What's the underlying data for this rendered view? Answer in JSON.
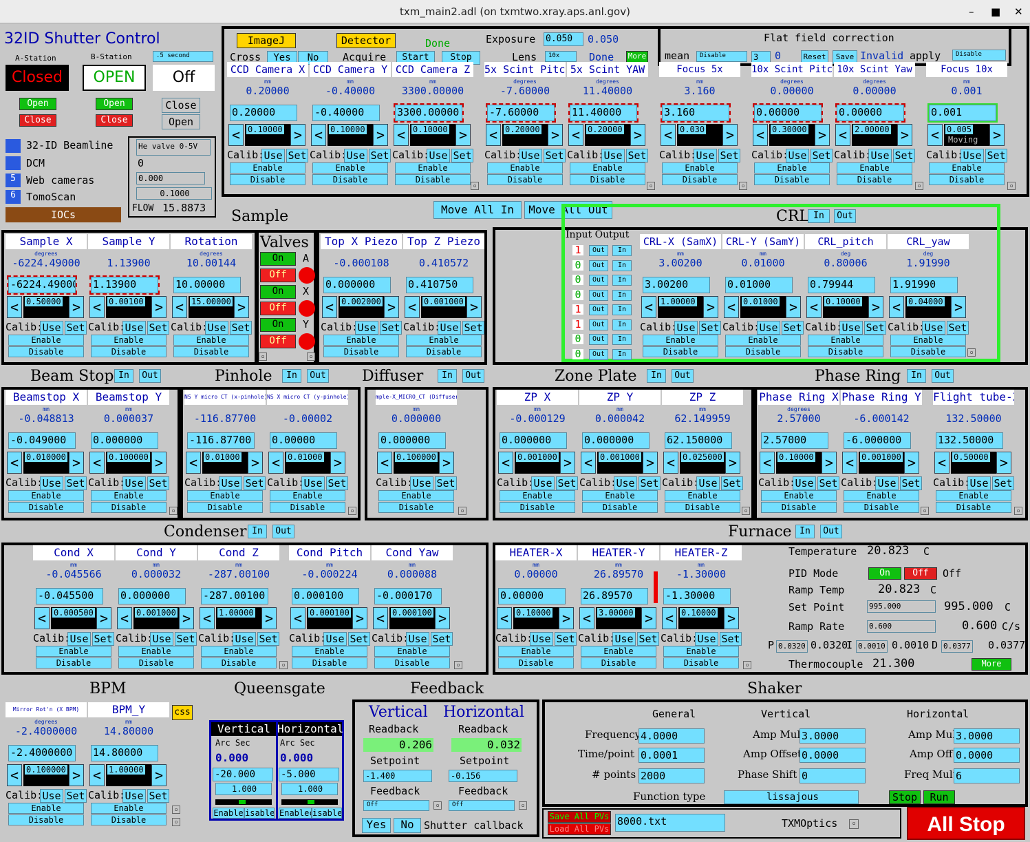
{
  "window": {
    "title": "txm_main2.adl (on txmtwo.xray.aps.anl.gov)",
    "minimize": "–",
    "maximize": "■",
    "close": "✕"
  },
  "shutter": {
    "title": "32ID Shutter Control",
    "a_label": "A-Station",
    "b_label": "B-Station",
    "a_state": "Closed",
    "b_state": "OPEN",
    "off": "Off",
    "rate": ".5 second",
    "open": "Open",
    "close": "Close",
    "close2": "Close",
    "open2": "Open",
    "colors": {
      "closed": "#e00000",
      "open": "#00a000"
    }
  },
  "nav": {
    "items": [
      {
        "num": "",
        "label": "32-ID Beamline"
      },
      {
        "num": "",
        "label": "DCM"
      },
      {
        "num": "5",
        "label": "Web cameras"
      },
      {
        "num": "6",
        "label": "TomoScan"
      }
    ],
    "iocs": "IOCs"
  },
  "he": {
    "label": "He valve 0-5V",
    "val": "0",
    "set": "0.000",
    "step": "0.1000",
    "flow_label": "FLOW",
    "flow": "15.8873"
  },
  "top": {
    "imagej": "ImageJ",
    "detector": "Detector",
    "done": "Done",
    "exposure": "Exposure",
    "exp_set": "0.050",
    "exp_rbv": "0.050",
    "cross": "Cross",
    "yes": "Yes",
    "no": "No",
    "acquire": "Acquire",
    "start": "Start",
    "stop": "Stop",
    "lens": "Lens",
    "lens_sel": "10x",
    "done2": "Done",
    "more": "More"
  },
  "flat": {
    "title": "Flat field correction",
    "mean": "mean",
    "mean_sel": "Disable",
    "n": "3",
    "n_rbv": "0",
    "reset": "Reset",
    "save": "Save",
    "invalid": "Invalid",
    "apply": "apply",
    "apply_sel": "Disable"
  },
  "calib_text": {
    "calib": "Calib:",
    "use": "Use",
    "set": "Set",
    "enable": "Enable",
    "disable": "Disable",
    "in": "In",
    "out": "Out"
  },
  "ccd_motors": [
    {
      "name": "CCD Camera X",
      "unit": "mm",
      "rbv": "0.20000",
      "set": "0.20000",
      "step": "0.10000"
    },
    {
      "name": "CCD Camera Y",
      "unit": "mm",
      "rbv": "-0.40000",
      "set": "-0.40000",
      "step": "0.10000"
    },
    {
      "name": "CCD Camera Z",
      "unit": "mm",
      "rbv": "3300.00000",
      "set": "3300.00000",
      "step": "0.10000"
    },
    {
      "name": "5x Scint Pitch",
      "unit": "degrees",
      "rbv": "-7.60000",
      "set": "-7.60000",
      "step": "0.20000"
    },
    {
      "name": "5x Scint YAW",
      "unit": "degrees",
      "rbv": "11.40000",
      "set": "11.40000",
      "step": "0.20000"
    },
    {
      "name": "Focus 5x",
      "unit": "mm",
      "rbv": "3.160",
      "set": "3.160",
      "step": "0.030"
    },
    {
      "name": "10x Scint Pitch",
      "unit": "degrees",
      "rbv": "0.00000",
      "set": "0.00000",
      "step": "0.30000"
    },
    {
      "name": "10x Scint Yaw",
      "unit": "degrees",
      "rbv": "0.00000",
      "set": "0.00000",
      "step": "2.00000"
    },
    {
      "name": "Focus 10x",
      "unit": "mm",
      "rbv": "0.001",
      "set": "0.001",
      "step": "0.005",
      "moving": "Moving"
    }
  ],
  "sample": {
    "title": "Sample",
    "move_all_in": "Move All In",
    "move_all_out": "Move All Out",
    "motors": [
      {
        "name": "Sample X",
        "unit": "degrees",
        "rbv": "-6224.49000",
        "set": "-6224.49000",
        "step": "0.50000"
      },
      {
        "name": "Sample Y",
        "unit": "",
        "rbv": "1.13900",
        "set": "1.13900",
        "step": "0.00100"
      },
      {
        "name": "Rotation",
        "unit": "degrees",
        "rbv": "10.00144",
        "set": "10.00000",
        "step": "15.00000"
      }
    ]
  },
  "valves": {
    "title": "Valves",
    "rows": [
      {
        "state": "On",
        "lbl": "A"
      },
      {
        "state": "Off",
        "lbl": ""
      },
      {
        "state": "On",
        "lbl": "X"
      },
      {
        "state": "Off",
        "lbl": ""
      },
      {
        "state": "On",
        "lbl": "Y"
      },
      {
        "state": "Off",
        "lbl": ""
      }
    ]
  },
  "piezo": [
    {
      "name": "Top X Piezo",
      "unit": "",
      "rbv": "-0.000108",
      "set": "0.000000",
      "step": "0.002000"
    },
    {
      "name": "Top Z Piezo",
      "unit": "",
      "rbv": "0.410572",
      "set": "0.410750",
      "step": "0.001000"
    }
  ],
  "crl": {
    "title": "CRL",
    "in": "In",
    "out": "Out",
    "io_header": "Input Output",
    "bits": [
      "1",
      "0",
      "0",
      "0",
      "1",
      "1",
      "0",
      "0"
    ],
    "motors": [
      {
        "name": "CRL-X (SamX)",
        "unit": "mm",
        "rbv": "3.00200",
        "set": "3.00200",
        "step": "1.00000"
      },
      {
        "name": "CRL-Y (SamY)",
        "unit": "mm",
        "rbv": "0.01000",
        "set": "0.01000",
        "step": "0.01000"
      },
      {
        "name": "CRL_pitch",
        "unit": "deg",
        "rbv": "0.80006",
        "set": "0.79944",
        "step": "0.10000"
      },
      {
        "name": "CRL_yaw",
        "unit": "deg",
        "rbv": "1.91990",
        "set": "1.91990",
        "step": "0.04000"
      }
    ]
  },
  "beamstop": {
    "title": "Beam Stop",
    "motors": [
      {
        "name": "Beamstop X",
        "unit": "mm",
        "rbv": "-0.048813",
        "set": "-0.049000",
        "step": "0.010000"
      },
      {
        "name": "Beamstop Y",
        "unit": "mm",
        "rbv": "0.000037",
        "set": "0.000000",
        "step": "0.100000"
      }
    ]
  },
  "pinhole": {
    "title": "Pinhole",
    "motors": [
      {
        "name": "NS Y micro CT (x-pinhole)",
        "unit": "",
        "rbv": "-116.87700",
        "set": "-116.87700",
        "step": "0.01000"
      },
      {
        "name": "NS X micro CT (y-pinhole)",
        "unit": "",
        "rbv": "-0.00002",
        "set": "0.00000",
        "step": "0.01000"
      }
    ]
  },
  "diffuser": {
    "title": "Diffuser",
    "motors": [
      {
        "name": "mple-X_MICRO_CT (Diffuser)",
        "unit": "mm",
        "rbv": "0.000000",
        "set": "0.000000",
        "step": "0.100000"
      }
    ]
  },
  "zoneplate": {
    "title": "Zone Plate",
    "motors": [
      {
        "name": "ZP X",
        "unit": "mm",
        "rbv": "-0.000129",
        "set": "0.000000",
        "step": "0.001000"
      },
      {
        "name": "ZP Y",
        "unit": "mm",
        "rbv": "0.000042",
        "set": "0.000000",
        "step": "0.001000"
      },
      {
        "name": "ZP Z",
        "unit": "mm",
        "rbv": "62.149959",
        "set": "62.150000",
        "step": "0.025000"
      }
    ]
  },
  "phasering": {
    "title": "Phase Ring",
    "motors": [
      {
        "name": "Phase Ring X",
        "unit": "degrees",
        "rbv": "2.57000",
        "set": "2.57000",
        "step": "0.10000"
      },
      {
        "name": "Phase Ring Y",
        "unit": "",
        "rbv": "-6.000142",
        "set": "-6.000000",
        "step": "0.001000"
      },
      {
        "name": "Flight tube-Z",
        "unit": "",
        "rbv": "132.50000",
        "set": "132.50000",
        "step": "0.50000"
      }
    ]
  },
  "condenser": {
    "title": "Condenser",
    "motors": [
      {
        "name": "Cond X",
        "unit": "mm",
        "rbv": "-0.045566",
        "set": "-0.045500",
        "step": "0.000500"
      },
      {
        "name": "Cond Y",
        "unit": "mm",
        "rbv": "0.000032",
        "set": "0.000000",
        "step": "0.001000"
      },
      {
        "name": "Cond Z",
        "unit": "mm",
        "rbv": "-287.00100",
        "set": "-287.00100",
        "step": "1.00000"
      },
      {
        "name": "Cond Pitch",
        "unit": "mm",
        "rbv": "-0.000224",
        "set": "0.000100",
        "step": "0.000100"
      },
      {
        "name": "Cond Yaw",
        "unit": "mm",
        "rbv": "0.000088",
        "set": "-0.000170",
        "step": "0.000100"
      }
    ]
  },
  "furnace": {
    "title": "Furnace",
    "motors": [
      {
        "name": "HEATER-X",
        "unit": "mm",
        "rbv": "0.00000",
        "set": "0.00000",
        "step": "0.10000"
      },
      {
        "name": "HEATER-Y",
        "unit": "mm",
        "rbv": "26.89570",
        "set": "26.89570",
        "step": "3.00000"
      },
      {
        "name": "HEATER-Z",
        "unit": "mm",
        "rbv": "-1.30000",
        "set": "-1.30000",
        "step": "0.10000"
      }
    ],
    "temp_label": "Temperature",
    "temp": "20.823",
    "C": "C",
    "pid": "PID Mode",
    "on": "On",
    "off": "Off",
    "off_state": "Off",
    "ramp_temp_label": "Ramp Temp",
    "ramp_temp": "20.823",
    "setpoint_label": "Set Point",
    "setpoint_in": "995.000",
    "setpoint": "995.000",
    "ramp_rate_label": "Ramp Rate",
    "ramp_rate_in": "0.600",
    "ramp_rate": "0.600",
    "cs": "C/s",
    "p": "P",
    "p_in": "0.0320",
    "p_v": "0.0320",
    "i": "I",
    "i_in": "0.0010",
    "i_v": "0.0010",
    "d": "D",
    "d_in": "0.0377",
    "d_v": "0.0377",
    "tc_label": "Thermocouple",
    "tc": "21.300",
    "more": "More"
  },
  "bpm": {
    "title": "BPM",
    "css": "css",
    "motors": [
      {
        "name": "Mirror Rot'n (X BPM)",
        "unit": "degrees",
        "rbv": "-2.4000000",
        "set": "-2.4000000",
        "step": "0.100000"
      },
      {
        "name": "BPM_Y",
        "unit": "mm",
        "rbv": "14.80000",
        "set": "14.80000",
        "step": "1.00000"
      }
    ]
  },
  "queensgate": {
    "title": "Queensgate",
    "v": "Vertical",
    "h": "Horizontal",
    "arc": "Arc Sec",
    "v_val": "0.000",
    "h_val": "0.000",
    "v_set": "-20.000",
    "h_set": "-5.000",
    "v_step": "1.000",
    "h_step": "1.000",
    "v_en": "Enable",
    "v_dis": "isable",
    "h_en": "Enablec",
    "h_dis": "isable"
  },
  "feedback": {
    "title": "Feedback",
    "v": "Vertical",
    "h": "Horizontal",
    "readback": "Readback",
    "v_rb": "0.206",
    "h_rb": "0.032",
    "setpoint": "Setpoint",
    "v_sp": "-1.400",
    "h_sp": "-0.156",
    "fb": "Feedback",
    "v_fb": "Off",
    "h_fb": "Off",
    "yes": "Yes",
    "no": "No",
    "shutter_cb": "Shutter callback"
  },
  "shaker": {
    "title": "Shaker",
    "general": "General",
    "vertical": "Vertical",
    "horizontal": "Horizontal",
    "freq_l": "Frequency",
    "freq": "4.0000",
    "tp_l": "Time/point",
    "tp": "0.0001",
    "np_l": "# points",
    "np": "2000",
    "ft_l": "Function type",
    "ft": "lissajous",
    "v_am_l": "Amp Mult",
    "v_am": "3.0000",
    "v_ao_l": "Amp Offset",
    "v_ao": "0.0000",
    "v_ps_l": "Phase Shift",
    "v_ps": "0",
    "h_am_l": "Amp Mult",
    "h_am": "3.0000",
    "h_ao_l": "Amp Off",
    "h_ao": "0.0000",
    "h_fm_l": "Freq Mult",
    "h_fm": "6",
    "stop": "Stop",
    "run": "Run"
  },
  "bottom": {
    "save_all": "Save All PVs",
    "load_all": "Load All PVs",
    "file": "8000.txt",
    "txmoptics": "TXMOptics",
    "all_stop": "All Stop"
  }
}
